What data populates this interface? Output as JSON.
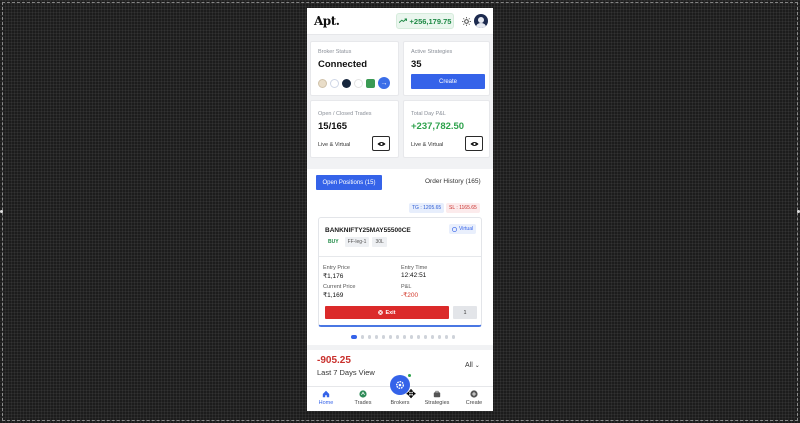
{
  "header": {
    "logo": "Apt.",
    "pnl": "+256,179.75"
  },
  "broker_card": {
    "label": "Broker Status",
    "value": "Connected"
  },
  "strategies_card": {
    "label": "Active Strategies",
    "value": "35",
    "button": "Create"
  },
  "trades_card": {
    "label": "Open / Closed Trades",
    "value": "15/165",
    "sub": "Live & Virtual"
  },
  "pnl_card": {
    "label": "Total Day P&L",
    "value": "+237,782.50",
    "sub": "Live & Virtual"
  },
  "tabs": {
    "open": "Open Positions (15)",
    "history": "Order History (165)"
  },
  "badges": {
    "tg": "TG : 1205.65",
    "sl": "SL : 1165.65"
  },
  "position": {
    "symbol": "BANKNIFTY25MAY55500CE",
    "mode": "Virtual",
    "side": "BUY",
    "leg": "FF-leg-1",
    "qty": "30L",
    "entry_price_label": "Entry Price",
    "entry_price": "₹1,176",
    "entry_time_label": "Entry Time",
    "entry_time": "12:42:51",
    "current_price_label": "Current Price",
    "current_price": "₹1,169",
    "pnl_label": "P&L",
    "pnl": "-₹200",
    "exit_label": "Exit",
    "exit_qty": "1"
  },
  "carousel": {
    "count": 15,
    "active_index": 0
  },
  "summary": {
    "value": "-905.25",
    "label": "Last 7 Days View",
    "filter": "All"
  },
  "nav": {
    "home": "Home",
    "trades": "Trades",
    "brokers": "Brokers",
    "strategies": "Strategies",
    "create": "Create"
  },
  "colors": {
    "accent": "#3563e9",
    "positive": "#1f8a46",
    "negative": "#d33a2c"
  }
}
